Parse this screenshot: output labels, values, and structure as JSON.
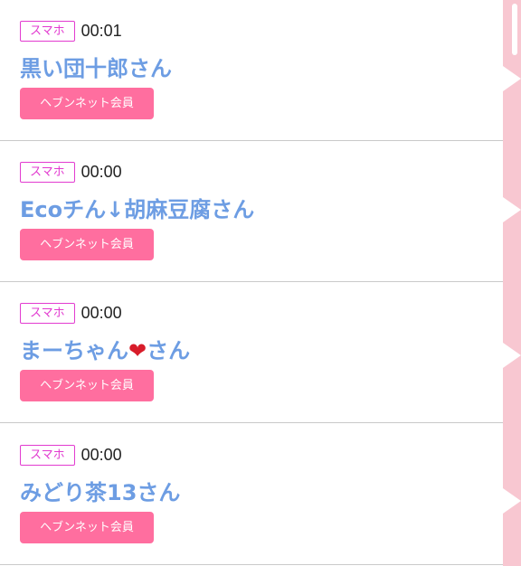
{
  "members": [
    {
      "device": "スマホ",
      "time": "00:01",
      "name": "黒い団十郎さん",
      "badge": "ヘブンネット会員"
    },
    {
      "device": "スマホ",
      "time": "00:00",
      "name": "Ecoチん↓胡麻豆腐さん",
      "badge": "ヘブンネット会員"
    },
    {
      "device": "スマホ",
      "time": "00:00",
      "name_prefix": "まーちゃん",
      "name_emoji": "❤",
      "name_suffix": "さん",
      "badge": "ヘブンネット会員"
    },
    {
      "device": "スマホ",
      "time": "00:00",
      "name": "みどり茶13さん",
      "badge": "ヘブンネット会員"
    }
  ],
  "colors": {
    "device_tag": "#e23bd0",
    "name": "#6d9de3",
    "badge_bg": "#ff6e9f",
    "side_panel": "#f8c7d1"
  }
}
